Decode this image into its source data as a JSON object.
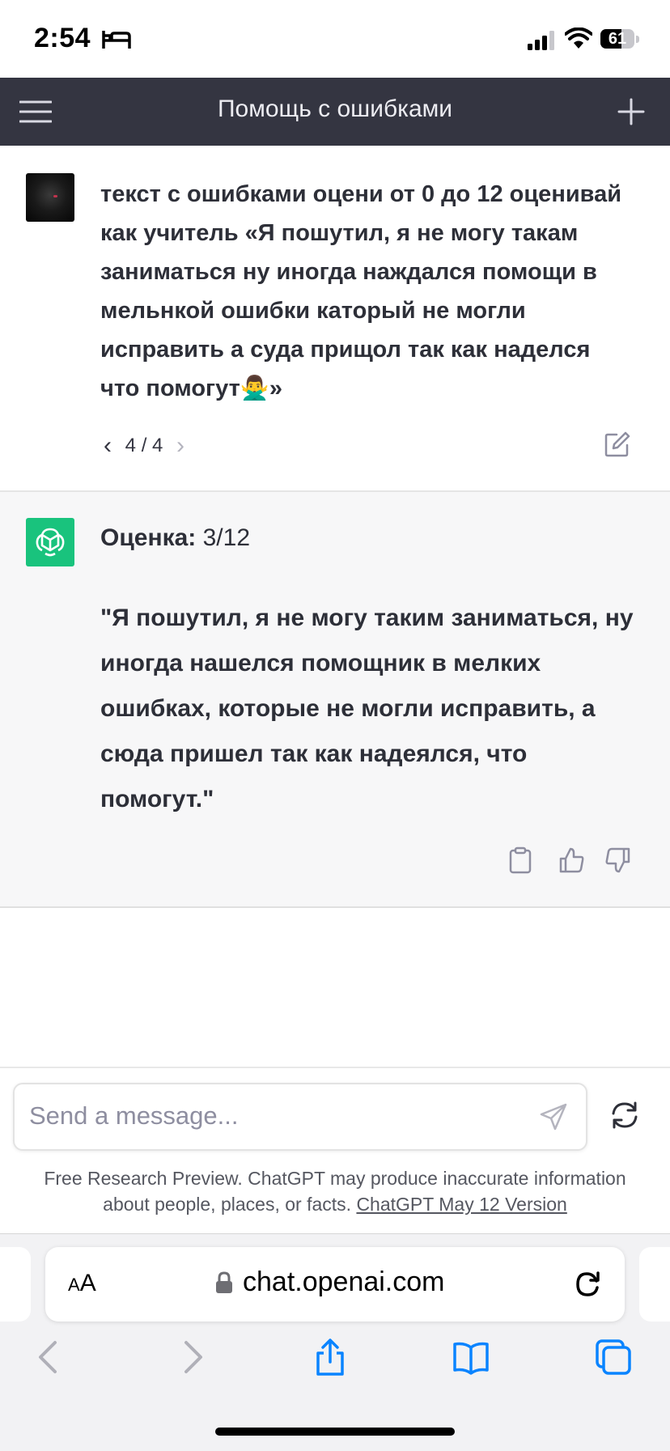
{
  "status_bar": {
    "time": "2:54",
    "battery_level": "61",
    "battery_fraction": 0.61
  },
  "header": {
    "title": "Помощь с ошибками"
  },
  "user_message": {
    "text": "текст с ошибками оцени от 0 до 12 оценивай как учитель «Я пошутил, я не могу такам заниматься ну иногда наждался помощи в мельнкой ошибки каторый не могли исправить а суда прищол так как наделся что помогут🙅‍♂️»",
    "pager": {
      "prev": "‹",
      "label": "4 / 4",
      "next": "›"
    }
  },
  "assistant_message": {
    "rating_label": "Оценка:",
    "rating_value": " 3/12",
    "corrected_text": "\"Я пошутил, я не могу таким заниматься, ну иногда нашелся помощник в мелких ошибках, которые не могли исправить, а сюда пришел так как надеялся, что помогут.\""
  },
  "composer": {
    "placeholder": "Send a message...",
    "disclaimer_text": "Free Research Preview. ChatGPT may produce inaccurate information about people, places, or facts. ",
    "version_link": "ChatGPT May 12 Version"
  },
  "safari": {
    "aa_small": "A",
    "aa_large": "A",
    "url": "chat.openai.com"
  },
  "colors": {
    "header_bg": "#343541",
    "assistant_bg": "#f7f7f8",
    "openai_green": "#19c37d",
    "safari_blue": "#0a84ff"
  },
  "icons": [
    "sleep-icon",
    "signal-icon",
    "wifi-icon",
    "menu-icon",
    "plus-icon",
    "edit-icon",
    "openai-logo-icon",
    "copy-icon",
    "thumbs-up-icon",
    "thumbs-down-icon",
    "send-icon",
    "regenerate-icon",
    "lock-icon",
    "reload-icon",
    "back-icon",
    "forward-icon",
    "share-icon",
    "bookmarks-icon",
    "tabs-icon"
  ]
}
